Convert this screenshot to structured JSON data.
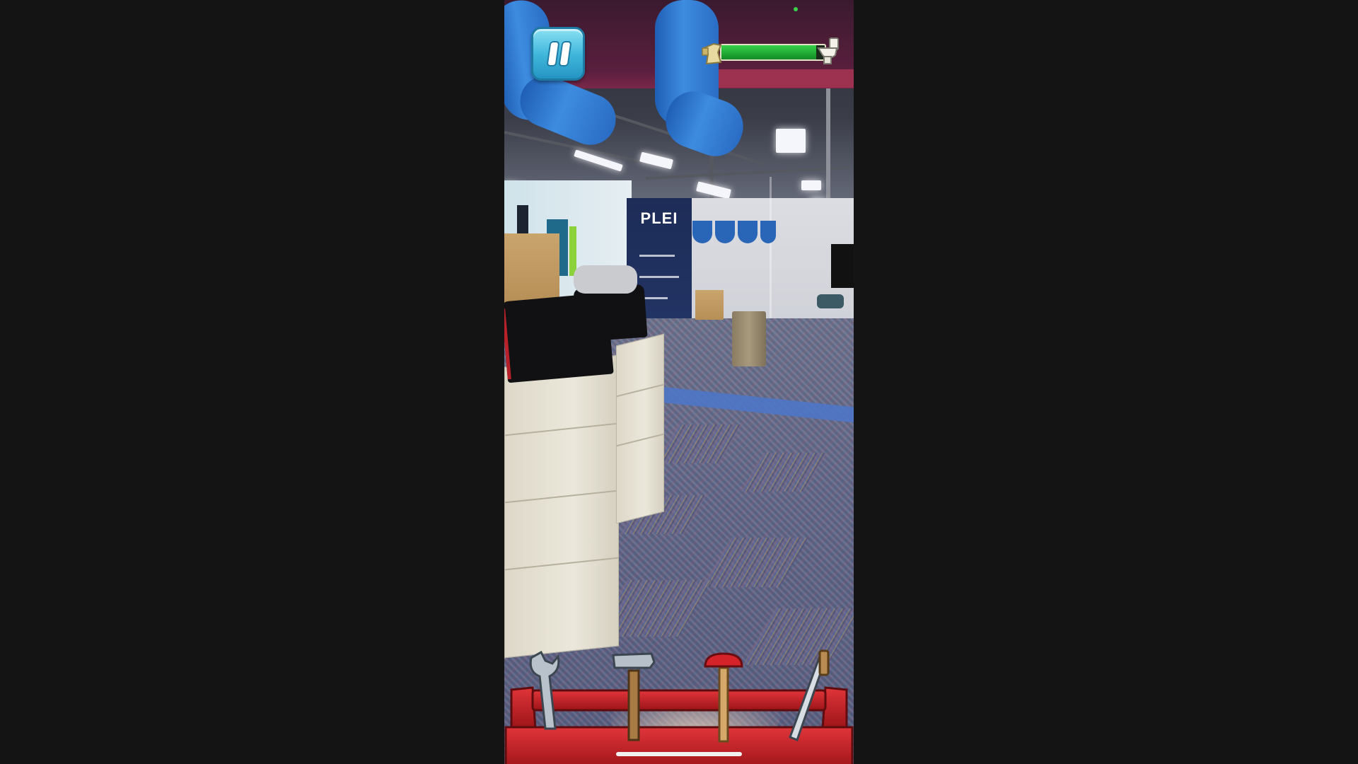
{
  "hud": {
    "pause_icon": "pause-icon",
    "level_progress": 0.92,
    "progress_start_icon": "plumber-start-icon",
    "progress_goal_icon": "toilet-icon",
    "progress_color": "#22b537"
  },
  "scene": {
    "banner_title": "PLEI"
  },
  "toolbox": {
    "tools": [
      {
        "name": "wrench",
        "icon": "wrench-icon"
      },
      {
        "name": "hammer",
        "icon": "hammer-icon"
      },
      {
        "name": "plunger",
        "icon": "plunger-icon"
      },
      {
        "name": "saw",
        "icon": "saw-icon"
      }
    ],
    "accent_color": "#c8262a"
  }
}
